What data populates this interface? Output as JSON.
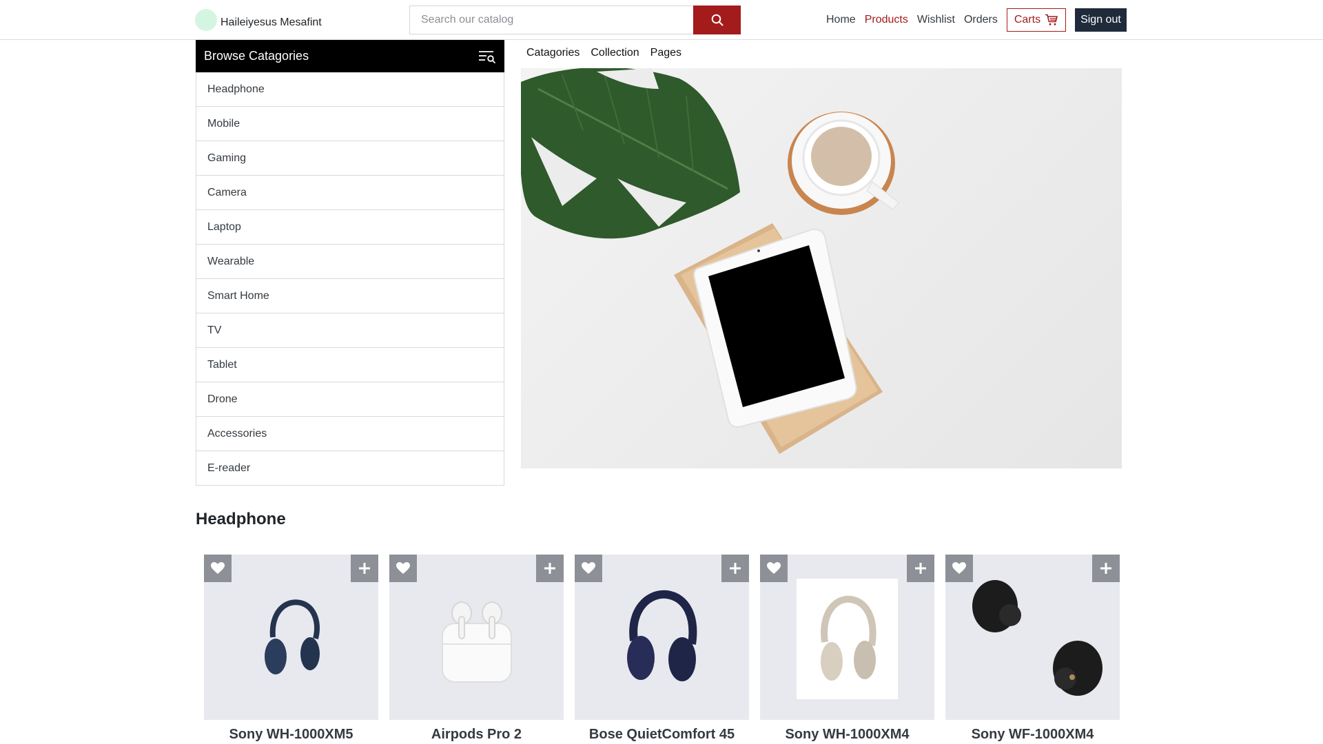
{
  "brand": {
    "name": "Haileiyesus Mesafint"
  },
  "search": {
    "placeholder": "Search our catalog"
  },
  "nav": {
    "links": [
      {
        "label": "Home",
        "active": false
      },
      {
        "label": "Products",
        "active": true
      },
      {
        "label": "Wishlist",
        "active": false
      },
      {
        "label": "Orders",
        "active": false
      }
    ],
    "cart_label": "Carts",
    "signout_label": "Sign out"
  },
  "sidebar": {
    "title": "Browse Catagories",
    "items": [
      {
        "label": "Headphone"
      },
      {
        "label": "Mobile"
      },
      {
        "label": "Gaming"
      },
      {
        "label": "Camera"
      },
      {
        "label": "Laptop"
      },
      {
        "label": "Wearable"
      },
      {
        "label": "Smart Home"
      },
      {
        "label": "TV"
      },
      {
        "label": "Tablet"
      },
      {
        "label": "Drone"
      },
      {
        "label": "Accessories"
      },
      {
        "label": "E-reader"
      }
    ]
  },
  "subnav": {
    "links": [
      {
        "label": "Catagories"
      },
      {
        "label": "Collection"
      },
      {
        "label": "Pages"
      }
    ]
  },
  "section": {
    "title": "Headphone"
  },
  "products": [
    {
      "name": "Sony WH-1000XM5"
    },
    {
      "name": "Airpods Pro 2"
    },
    {
      "name": "Bose QuietComfort 45"
    },
    {
      "name": "Sony WH-1000XM4"
    },
    {
      "name": "Sony WF-1000XM4"
    }
  ],
  "colors": {
    "accent": "#a31b1b",
    "dark": "#1f2b3a",
    "card_bg": "#e8e9ee",
    "icon_btn_bg": "#8d9096"
  },
  "icons": {
    "search": "search-icon",
    "cart": "cart-icon",
    "filter": "filter-search-icon",
    "wishlist": "heart-icon",
    "add": "plus-icon"
  }
}
